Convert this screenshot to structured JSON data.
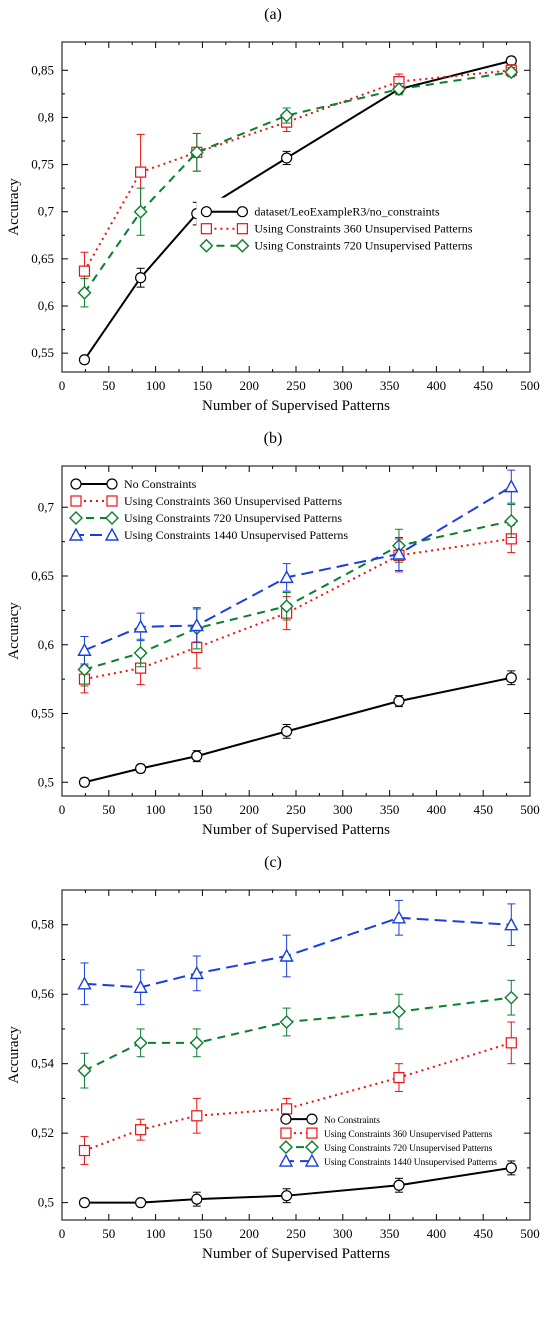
{
  "chart_data": [
    {
      "id": "a",
      "subplot_label": "(a)",
      "type": "line",
      "xlabel": "Number of Supervised Patterns",
      "ylabel": "Accuracy",
      "xlim": [
        0,
        500
      ],
      "ylim": [
        0.53,
        0.88
      ],
      "xticks": [
        0,
        50,
        100,
        150,
        200,
        250,
        300,
        350,
        400,
        450,
        500
      ],
      "yticks": [
        0.55,
        0.6,
        0.65,
        0.7,
        0.75,
        0.8,
        0.85
      ],
      "ytick_labels": [
        "0,55",
        "0,6",
        "0,65",
        "0,7",
        "0,75",
        "0,8",
        "0,85"
      ],
      "x": [
        24,
        84,
        144,
        240,
        360,
        480
      ],
      "legend_pos": "inside-lower-right",
      "series": [
        {
          "name": "dataset/LeoExampleR3/no_constraints",
          "color": "black",
          "style": "solid",
          "marker": "circle",
          "y": [
            0.543,
            0.63,
            0.698,
            0.757,
            0.83,
            0.86
          ],
          "err": [
            0.004,
            0.01,
            0.012,
            0.007,
            0.004,
            0.004
          ]
        },
        {
          "name": "Using Constraints 360 Unsupervised Patterns",
          "color": "red",
          "style": "dot",
          "marker": "square",
          "y": [
            0.637,
            0.742,
            0.763,
            0.795,
            0.838,
            0.85
          ],
          "err": [
            0.02,
            0.04,
            0.02,
            0.01,
            0.008,
            0.006
          ]
        },
        {
          "name": "Using Constraints 720 Unsupervised Patterns",
          "color": "green",
          "style": "dash",
          "marker": "diamond",
          "y": [
            0.614,
            0.7,
            0.763,
            0.802,
            0.83,
            0.848
          ],
          "err": [
            0.015,
            0.025,
            0.02,
            0.008,
            0.006,
            0.005
          ]
        }
      ]
    },
    {
      "id": "b",
      "subplot_label": "(b)",
      "type": "line",
      "xlabel": "Number of Supervised Patterns",
      "ylabel": "Accuracy",
      "xlim": [
        0,
        500
      ],
      "ylim": [
        0.49,
        0.73
      ],
      "xticks": [
        0,
        50,
        100,
        150,
        200,
        250,
        300,
        350,
        400,
        450,
        500
      ],
      "yticks": [
        0.5,
        0.55,
        0.6,
        0.65,
        0.7
      ],
      "ytick_labels": [
        "0,5",
        "0,55",
        "0,6",
        "0,65",
        "0,7"
      ],
      "x": [
        24,
        84,
        144,
        240,
        360,
        480
      ],
      "legend_pos": "inside-upper-left",
      "series": [
        {
          "name": "No Constraints",
          "color": "black",
          "style": "solid",
          "marker": "circle",
          "y": [
            0.5,
            0.51,
            0.519,
            0.537,
            0.559,
            0.576
          ],
          "err": [
            0.003,
            0.003,
            0.004,
            0.005,
            0.004,
            0.005
          ]
        },
        {
          "name": "Using Constraints 360 Unsupervised Patterns",
          "color": "red",
          "style": "dot",
          "marker": "square",
          "y": [
            0.575,
            0.583,
            0.598,
            0.623,
            0.665,
            0.677
          ],
          "err": [
            0.01,
            0.012,
            0.015,
            0.012,
            0.012,
            0.01
          ]
        },
        {
          "name": "Using Constraints 720 Unsupervised Patterns",
          "color": "green",
          "style": "dash",
          "marker": "diamond",
          "y": [
            0.582,
            0.594,
            0.612,
            0.628,
            0.672,
            0.69
          ],
          "err": [
            0.012,
            0.01,
            0.015,
            0.01,
            0.012,
            0.012
          ]
        },
        {
          "name": "Using Constraints 1440 Unsupervised Patterns",
          "color": "blue",
          "style": "longdash",
          "marker": "triangle",
          "y": [
            0.596,
            0.613,
            0.614,
            0.649,
            0.666,
            0.715
          ],
          "err": [
            0.01,
            0.01,
            0.012,
            0.01,
            0.012,
            0.012
          ]
        }
      ]
    },
    {
      "id": "c",
      "subplot_label": "(c)",
      "type": "line",
      "xlabel": "Number of Supervised Patterns",
      "ylabel": "Accuracy",
      "xlim": [
        0,
        500
      ],
      "ylim": [
        0.495,
        0.59
      ],
      "xticks": [
        0,
        50,
        100,
        150,
        200,
        250,
        300,
        350,
        400,
        450,
        500
      ],
      "yticks": [
        0.5,
        0.52,
        0.54,
        0.56,
        0.58
      ],
      "ytick_labels": [
        "0,5",
        "0,52",
        "0,54",
        "0,56",
        "0,58"
      ],
      "x": [
        24,
        84,
        144,
        240,
        360,
        480
      ],
      "legend_pos": "inside-lower-right-small",
      "series": [
        {
          "name": "No Constraints",
          "color": "black",
          "style": "solid",
          "marker": "circle",
          "y": [
            0.5,
            0.5,
            0.501,
            0.502,
            0.505,
            0.51
          ],
          "err": [
            0.001,
            0.001,
            0.002,
            0.002,
            0.002,
            0.002
          ]
        },
        {
          "name": "Using Constraints 360 Unsupervised Patterns",
          "color": "red",
          "style": "dot",
          "marker": "square",
          "y": [
            0.515,
            0.521,
            0.525,
            0.527,
            0.536,
            0.546
          ],
          "err": [
            0.004,
            0.003,
            0.005,
            0.003,
            0.004,
            0.006
          ]
        },
        {
          "name": "Using Constraints 720 Unsupervised Patterns",
          "color": "green",
          "style": "dash",
          "marker": "diamond",
          "y": [
            0.538,
            0.546,
            0.546,
            0.552,
            0.555,
            0.559
          ],
          "err": [
            0.005,
            0.004,
            0.004,
            0.004,
            0.005,
            0.005
          ]
        },
        {
          "name": "Using Constraints 1440 Unsupervised Patterns",
          "color": "blue",
          "style": "longdash",
          "marker": "triangle",
          "y": [
            0.563,
            0.562,
            0.566,
            0.571,
            0.582,
            0.58
          ],
          "err": [
            0.006,
            0.005,
            0.005,
            0.006,
            0.005,
            0.006
          ]
        }
      ]
    }
  ]
}
